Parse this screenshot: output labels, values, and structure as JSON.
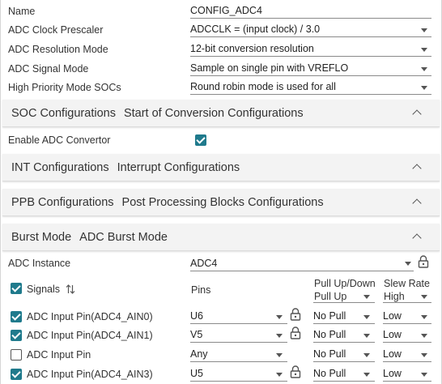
{
  "top_fields": [
    {
      "label": "Name",
      "value": "CONFIG_ADC4",
      "dropdown": false
    },
    {
      "label": "ADC Clock Prescaler",
      "value": "ADCCLK = (input clock) / 3.0",
      "dropdown": true
    },
    {
      "label": "ADC Resolution Mode",
      "value": "12-bit conversion resolution",
      "dropdown": true
    },
    {
      "label": "ADC Signal Mode",
      "value": "Sample on single pin with VREFLO",
      "dropdown": true
    },
    {
      "label": "High Priority Mode SOCs",
      "value": "Round robin mode is used for all",
      "dropdown": true
    }
  ],
  "sections": [
    {
      "title": "SOC Configurations",
      "subtitle": "Start of Conversion Configurations"
    },
    {
      "title": "INT Configurations",
      "subtitle": "Interrupt Configurations"
    },
    {
      "title": "PPB Configurations",
      "subtitle": "Post Processing Blocks Configurations"
    },
    {
      "title": "Burst Mode",
      "subtitle": "ADC Burst Mode"
    }
  ],
  "enable_adc": {
    "label": "Enable ADC Convertor",
    "checked": true
  },
  "adc_instance": {
    "label": "ADC Instance",
    "value": "ADC4"
  },
  "signals_table": {
    "headers": {
      "signals": "Signals",
      "pins": "Pins",
      "pull": "Pull Up/Down",
      "pull_default": "Pull Up",
      "slew": "Slew Rate",
      "slew_default": "High"
    },
    "rows": [
      {
        "name": "ADC Input Pin(ADC4_AIN0)",
        "checked": true,
        "pin": "U6",
        "locked": true,
        "pull": "No Pull",
        "slew": "Low"
      },
      {
        "name": "ADC Input Pin(ADC4_AIN1)",
        "checked": true,
        "pin": "V5",
        "locked": true,
        "pull": "No Pull",
        "slew": "Low"
      },
      {
        "name": "ADC Input Pin",
        "checked": false,
        "pin": "Any",
        "locked": false,
        "pull": "No Pull",
        "slew": "Low"
      },
      {
        "name": "ADC Input Pin(ADC4_AIN3)",
        "checked": true,
        "pin": "U5",
        "locked": true,
        "pull": "No Pull",
        "slew": "Low"
      }
    ]
  },
  "colors": {
    "accent": "#1f7a8c",
    "section_bg": "#f3f3f3"
  }
}
